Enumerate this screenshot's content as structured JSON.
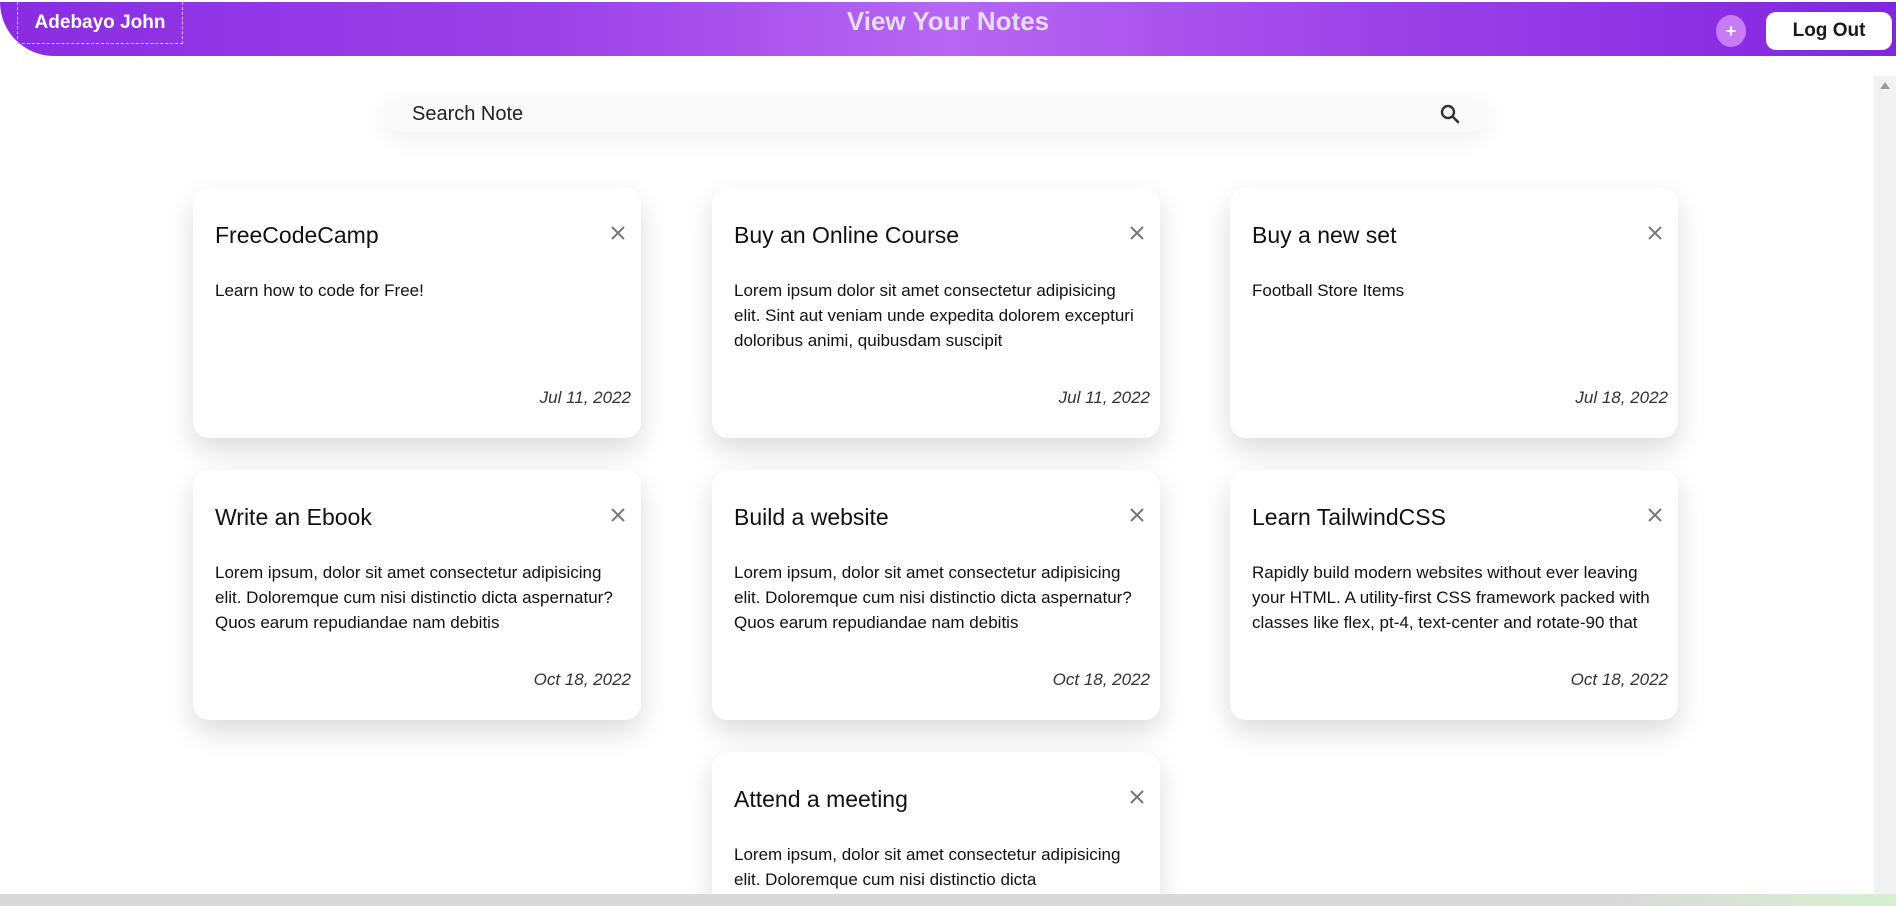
{
  "header": {
    "user_name": "Adebayo John",
    "title": "View Your Notes",
    "add_label": "+",
    "logout_label": "Log Out"
  },
  "search": {
    "placeholder": "Search Note"
  },
  "notes": [
    {
      "title": "FreeCodeCamp",
      "body": "Learn how to code for Free!",
      "date": "Jul 11, 2022"
    },
    {
      "title": "Buy an Online Course",
      "body": "Lorem ipsum dolor sit amet consectetur adipisicing elit. Sint aut veniam unde expedita dolorem excepturi doloribus animi, quibusdam suscipit",
      "date": "Jul 11, 2022"
    },
    {
      "title": "Buy a new set",
      "body": "Football Store Items",
      "date": "Jul 18, 2022"
    },
    {
      "title": "Write an Ebook",
      "body": "Lorem ipsum, dolor sit amet consectetur adipisicing elit. Doloremque cum nisi distinctio dicta aspernatur? Quos earum repudiandae nam debitis",
      "date": "Oct 18, 2022"
    },
    {
      "title": "Build a website",
      "body": "Lorem ipsum, dolor sit amet consectetur adipisicing elit. Doloremque cum nisi distinctio dicta aspernatur? Quos earum repudiandae nam debitis",
      "date": "Oct 18, 2022"
    },
    {
      "title": "Learn TailwindCSS",
      "body": "Rapidly build modern websites without ever leaving your HTML. A utility-first CSS framework packed with classes like flex, pt-4, text-center and rotate-90 that",
      "date": "Oct 18, 2022"
    },
    {
      "title": "Attend a meeting",
      "body": "Lorem ipsum, dolor sit amet consectetur adipisicing elit. Doloremque cum nisi distinctio dicta",
      "date": ""
    }
  ],
  "icons": {
    "search": "search-icon",
    "close": "close-icon",
    "add": "plus-icon"
  },
  "colors": {
    "header_start": "#8a2be2",
    "header_mid": "#b866f3",
    "add_button": "#c77cf6"
  }
}
